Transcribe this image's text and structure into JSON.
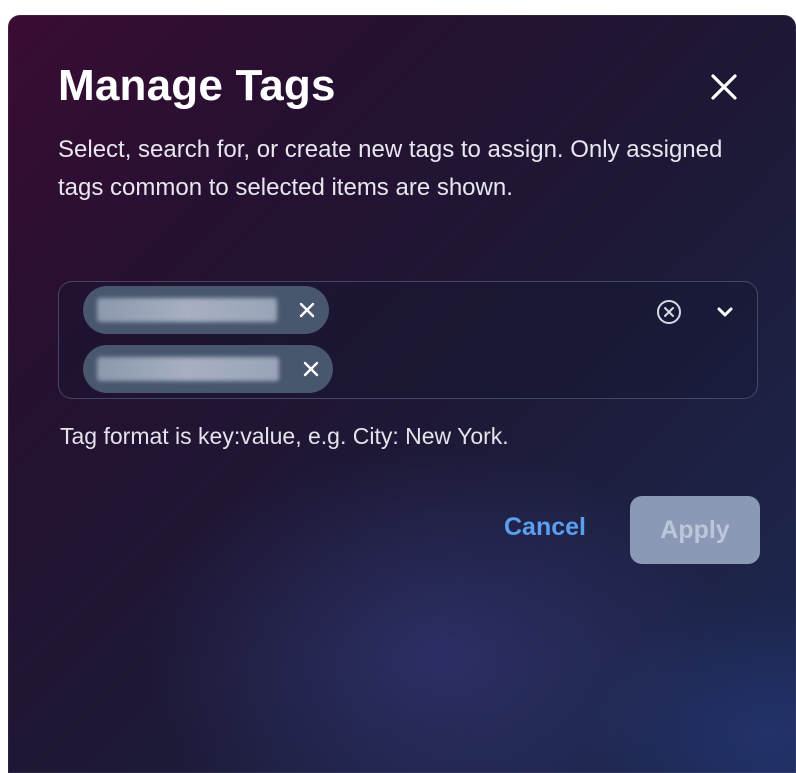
{
  "dialog": {
    "title": "Manage Tags",
    "description": "Select, search for, or create new tags to assign. Only assigned tags common to selected items are shown.",
    "tags": [
      {
        "label": "",
        "remove_icon": "close-icon"
      },
      {
        "label": "",
        "remove_icon": "close-icon"
      }
    ],
    "hint": "Tag format is key:value, e.g. City: New York.",
    "cancel_label": "Cancel",
    "apply_label": "Apply",
    "apply_disabled": true
  },
  "colors": {
    "accent_link": "#5a9ff0",
    "chip_background": "#48566e",
    "apply_disabled_bg": "#8b99b6",
    "title_text": "#ffffff"
  }
}
